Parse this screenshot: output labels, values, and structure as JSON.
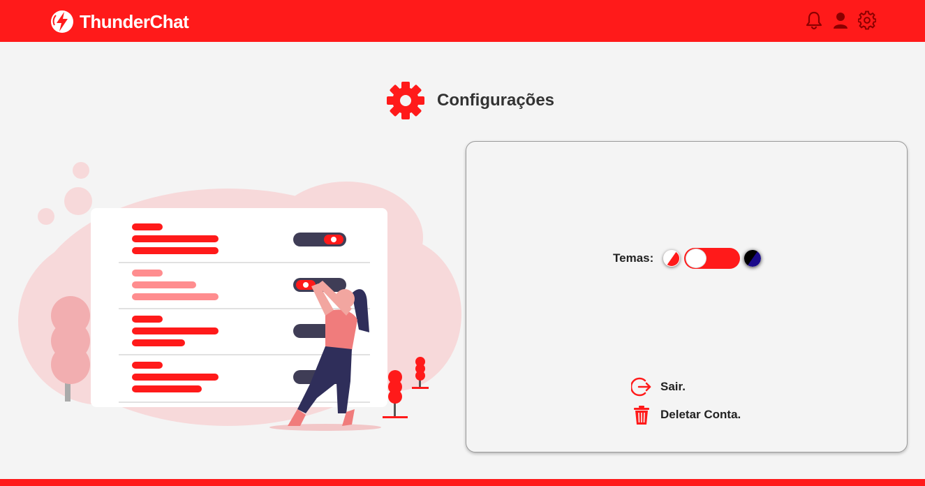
{
  "header": {
    "brand": "ThunderChat",
    "icons": [
      "bell-icon",
      "user-icon",
      "gear-icon"
    ],
    "brand_color": "#ff1a1a"
  },
  "page": {
    "title": "Configurações"
  },
  "settings": {
    "theme_label": "Temas:",
    "theme_toggle_state": "light",
    "logout_label": "Sair.",
    "delete_account_label": "Deletar Conta."
  },
  "colors": {
    "accent": "#ff1a1a",
    "background": "#f4f4f4",
    "text": "#222222"
  }
}
